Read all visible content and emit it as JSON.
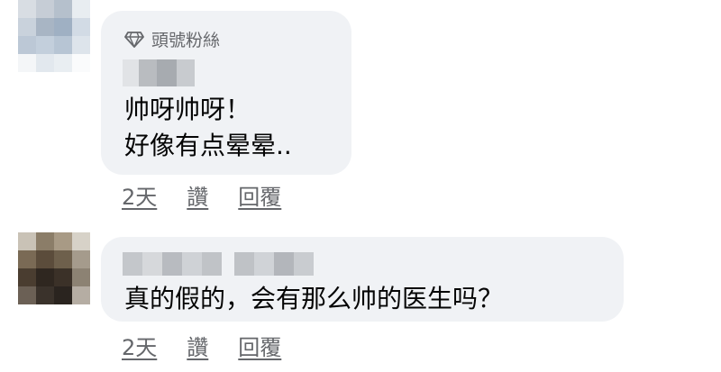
{
  "comments": [
    {
      "badge": "頭號粉絲",
      "badge_icon": "diamond-icon",
      "text": "帅呀帅呀！\n好像有点晕晕..",
      "actions": {
        "time": "2天",
        "like": "讚",
        "reply": "回覆"
      }
    },
    {
      "text": "真的假的，会有那么帅的医生吗？",
      "actions": {
        "time": "2天",
        "like": "讚",
        "reply": "回覆"
      }
    }
  ],
  "colors": {
    "bubble": "#f0f2f5",
    "text": "#050505",
    "secondary": "#65676b"
  }
}
